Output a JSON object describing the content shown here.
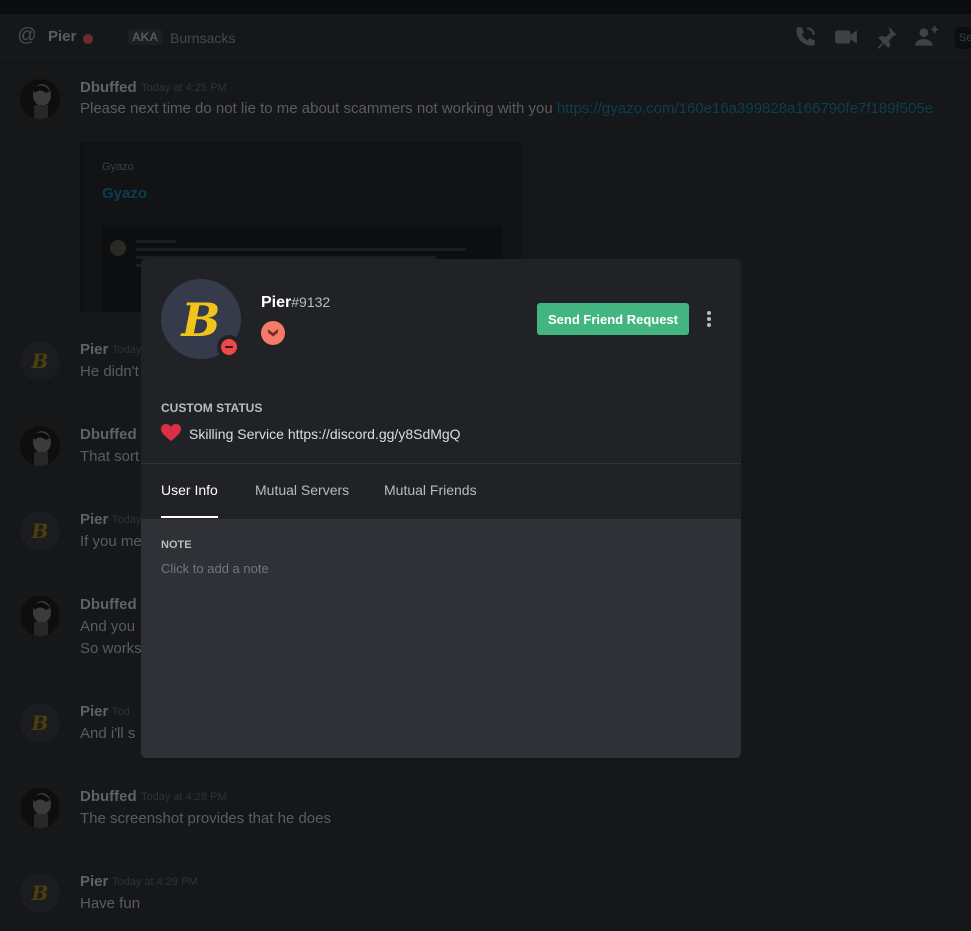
{
  "header": {
    "channel_name": "Pier",
    "aka_label": "AKA",
    "aka_names": "Burnsacks",
    "search_stub": "Se"
  },
  "messages": [
    {
      "author": "Dbuffed",
      "timestamp": "Today at 4:25 PM",
      "lines": [
        "Please next time do not lie to me about scammers not working with you "
      ],
      "link": "https://gyazo.com/160e16a399828a166790fe7f189f505e"
    },
    {
      "author": "Pier",
      "timestamp": "Today at",
      "lines": [
        "He didn't"
      ]
    },
    {
      "author": "Dbuffed",
      "timestamp": "",
      "lines": [
        "That sort"
      ]
    },
    {
      "author": "Pier",
      "timestamp": "Today",
      "lines": [
        "If you me"
      ]
    },
    {
      "author": "Dbuffed",
      "timestamp": "",
      "lines": [
        "And you",
        "So works"
      ]
    },
    {
      "author": "Pier",
      "timestamp": "Tod",
      "lines": [
        "And i'll s"
      ]
    },
    {
      "author": "Dbuffed",
      "timestamp": "Today at 4:28 PM",
      "lines": [
        "The screenshot provides that he does"
      ]
    },
    {
      "author": "Pier",
      "timestamp": "Today at 4:29 PM",
      "lines": [
        "Have fun"
      ]
    }
  ],
  "embed": {
    "provider": "Gyazo",
    "title": "Gyazo"
  },
  "profile": {
    "username": "Pier",
    "discriminator": "#9132",
    "avatar_letter": "B",
    "status": "dnd",
    "badge_icon": "hypesquad-bravery-icon",
    "friend_button": "Send Friend Request",
    "custom_status_heading": "CUSTOM STATUS",
    "custom_status_text": "Skilling Service https://discord.gg/y8SdMgQ",
    "tabs": [
      "User Info",
      "Mutual Servers",
      "Mutual Friends"
    ],
    "active_tab": "User Info",
    "note_heading": "NOTE",
    "note_placeholder": "Click to add a note"
  },
  "colors": {
    "accent_green": "#43b581",
    "dnd_red": "#f04747",
    "badge_orange": "#f47b67",
    "heart_red": "#dd2e44",
    "modal_bg": "#2f3136",
    "modal_header_bg": "#202225"
  }
}
